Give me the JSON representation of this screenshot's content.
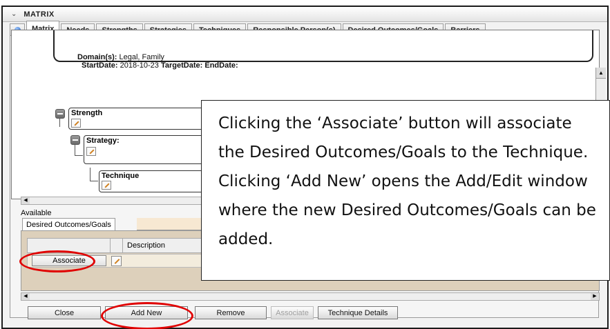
{
  "window": {
    "title": "MATRIX"
  },
  "tabs": [
    "Matrix",
    "Needs",
    "Strengths",
    "Strategies",
    "Techniques",
    "Responsible Person(s)",
    "Desired Outcomes/Goals",
    "Barriers"
  ],
  "active_tab": "Matrix",
  "goal": {
    "domain_label": "Domain(s):",
    "domain_value": "Legal, Family",
    "start_label": "StartDate:",
    "start_value": "2018-10-23",
    "target_label": "TargetDate:",
    "end_label": "EndDate:"
  },
  "tree": {
    "strength": "Strength",
    "strategy": "Strategy:",
    "technique": "Technique"
  },
  "available_label": "Available",
  "subtab": "Desired Outcomes/Goals",
  "grid": {
    "description_header": "Description",
    "row_button": "Associate"
  },
  "buttons": {
    "close": "Close",
    "add_new": "Add New",
    "remove": "Remove",
    "associate": "Associate",
    "technique_details": "Technique Details"
  },
  "callout": "Clicking the ‘Associate’ button will associate the Desired Outcomes/Goals to the Technique. Clicking ‘Add New’ opens the Add/Edit window where the new Desired Outcomes/Goals can be added.",
  "colors": {
    "highlight_ellipse": "#e00000",
    "available_strip": "#f7e8d2",
    "grid_background": "#ddd0bb"
  }
}
